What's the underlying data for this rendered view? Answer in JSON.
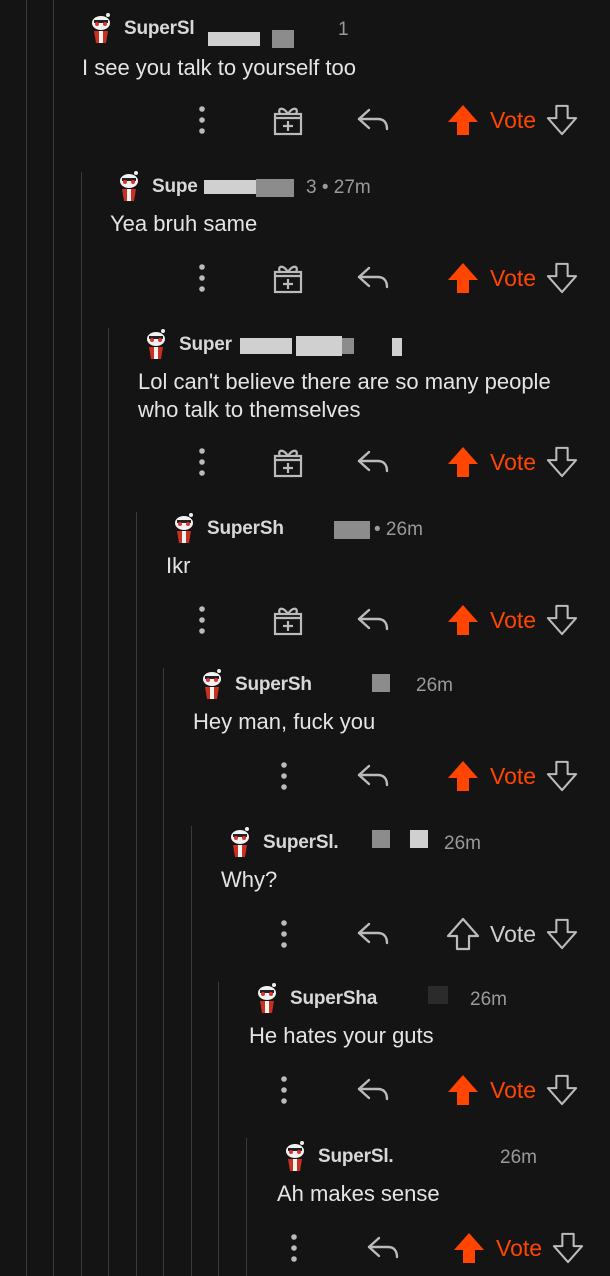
{
  "colors": {
    "background": "#141414",
    "upvote_active": "#ff4500",
    "text": "#e4e4e4",
    "muted": "#9a9a9a"
  },
  "comments": [
    {
      "username": "SuperSl",
      "time": "",
      "time_suffix": "1",
      "text": "I see you talk to yourself too",
      "upvoted": true,
      "has_award": true,
      "vote_label": "Vote"
    },
    {
      "username": "Supe",
      "time": "3 • 27m",
      "text": "Yea bruh same",
      "upvoted": true,
      "has_award": true,
      "vote_label": "Vote"
    },
    {
      "username": "Super",
      "time": "",
      "text": "Lol can't believe there are so many people\nwho talk to themselves",
      "upvoted": true,
      "has_award": true,
      "vote_label": "Vote"
    },
    {
      "username": "SuperSh",
      "time": "• 26m",
      "text": "Ikr",
      "upvoted": true,
      "has_award": true,
      "vote_label": "Vote"
    },
    {
      "username": "SuperSh",
      "time": "26m",
      "text": "Hey man, fuck you",
      "upvoted": true,
      "has_award": false,
      "vote_label": "Vote"
    },
    {
      "username": "SuperSl.",
      "time": "26m",
      "text": "Why?",
      "upvoted": false,
      "has_award": false,
      "vote_label": "Vote"
    },
    {
      "username": "SuperSha",
      "time": "26m",
      "text": "He hates your guts",
      "upvoted": true,
      "has_award": false,
      "vote_label": "Vote"
    },
    {
      "username": "SuperSl.",
      "time": "26m",
      "text": "Ah makes sense",
      "upvoted": true,
      "has_award": false,
      "vote_label": "Vote"
    }
  ],
  "icons": {
    "more": "more-vertical-icon",
    "award": "gift-icon",
    "reply": "reply-icon",
    "upvote": "upvote-arrow-icon",
    "downvote": "downvote-arrow-icon",
    "avatar": "snoo-avatar-icon"
  }
}
